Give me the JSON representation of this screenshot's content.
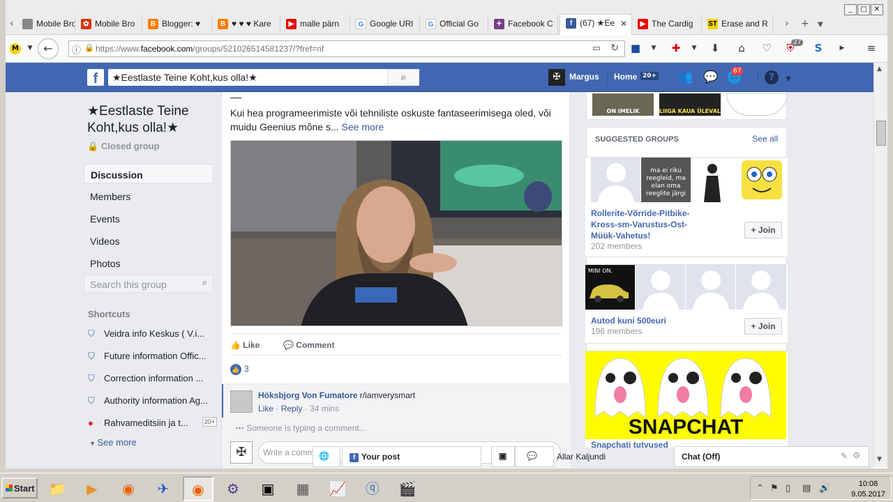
{
  "browser": {
    "tabs": [
      {
        "label": "Mobile Bro",
        "icon": "page-icon"
      },
      {
        "label": "Mobile Bro",
        "icon": "huawei-icon"
      },
      {
        "label": "Blogger: ♥",
        "icon": "blogger-icon"
      },
      {
        "label": "♥ ♥ ♥ Kare",
        "icon": "blogger-icon"
      },
      {
        "label": "malle pärn",
        "icon": "youtube-icon"
      },
      {
        "label": "Google URl",
        "icon": "google-icon"
      },
      {
        "label": "Official Go",
        "icon": "google-icon"
      },
      {
        "label": "Facebook C",
        "icon": "puzzle-icon"
      },
      {
        "label": "(67) ★Ee",
        "icon": "facebook-icon",
        "active": true
      },
      {
        "label": "The Cardig",
        "icon": "youtube-icon"
      },
      {
        "label": "Erase and R",
        "icon": "st-icon"
      }
    ],
    "url_prefix": "https://www.",
    "url_domain": "facebook.com",
    "url_path": "/groups/521026514581237/?fref=nf",
    "toolbar_badge": "27"
  },
  "facebook": {
    "search_value": "★Eestlaste Teine Koht,kus olla!★",
    "user_name": "Margus",
    "home_label": "Home",
    "home_count": "20+",
    "notif_count": "67"
  },
  "group": {
    "title": "★Eestlaste Teine Koht,kus olla!★",
    "type": "Closed group",
    "nav": [
      "Discussion",
      "Members",
      "Events",
      "Videos",
      "Photos"
    ],
    "search_placeholder": "Search this group",
    "shortcuts_heading": "Shortcuts",
    "shortcuts": [
      {
        "label": "Veidra info Keskus ( V.i...",
        "count": ""
      },
      {
        "label": "Future information Offic...",
        "count": ""
      },
      {
        "label": "Correction information ...",
        "count": ""
      },
      {
        "label": "Authority information Ag...",
        "count": ""
      },
      {
        "label": "Rahvameditsiin ja t...",
        "count": "20+"
      }
    ],
    "see_more": "See more"
  },
  "post": {
    "text": "Kui hea programeerimiste või tehniliste oskuste fantaseerimisega oled, või muidu Geenius mõne s...",
    "see_more": "See more",
    "like_label": "Like",
    "comment_label": "Comment",
    "likes_count": "3",
    "comment": {
      "author": "Höksbjorg Von Fumatore",
      "text": "r/iamverysmart",
      "like": "Like",
      "reply": "Reply",
      "time": "34 mins"
    },
    "typing": "Someone is typing a comment...",
    "comment_placeholder": "Write a comm"
  },
  "sidebar": {
    "top_captions": [
      "ON IMELIK",
      "LIIGA KAUA ÜLEVAL"
    ],
    "suggested_title": "SUGGESTED GROUPS",
    "see_all": "See all",
    "groups": [
      {
        "name": "Rollerite-Võrride-Pitbike-Kross-sm-Varustus-Ost-Müük-Vahetus!",
        "members": "202 members",
        "join": "Join",
        "thumb_text": "ma ei riku reegleid, ma elan oma reeglite järgi"
      },
      {
        "name": "Autod kuni 500euri",
        "members": "196 members",
        "join": "Join",
        "thumb_text": "MINI ON."
      },
      {
        "name": "Snapchati tutvused",
        "members": "",
        "join": "",
        "thumb_text": "SNAPCHAT"
      }
    ]
  },
  "chat": {
    "your_post": "Your post",
    "contact": "Allar Kaljundi",
    "chat_status": "Chat (Off)"
  },
  "taskbar": {
    "start": "Start",
    "time": "10:08",
    "date": "9.05.2017"
  }
}
